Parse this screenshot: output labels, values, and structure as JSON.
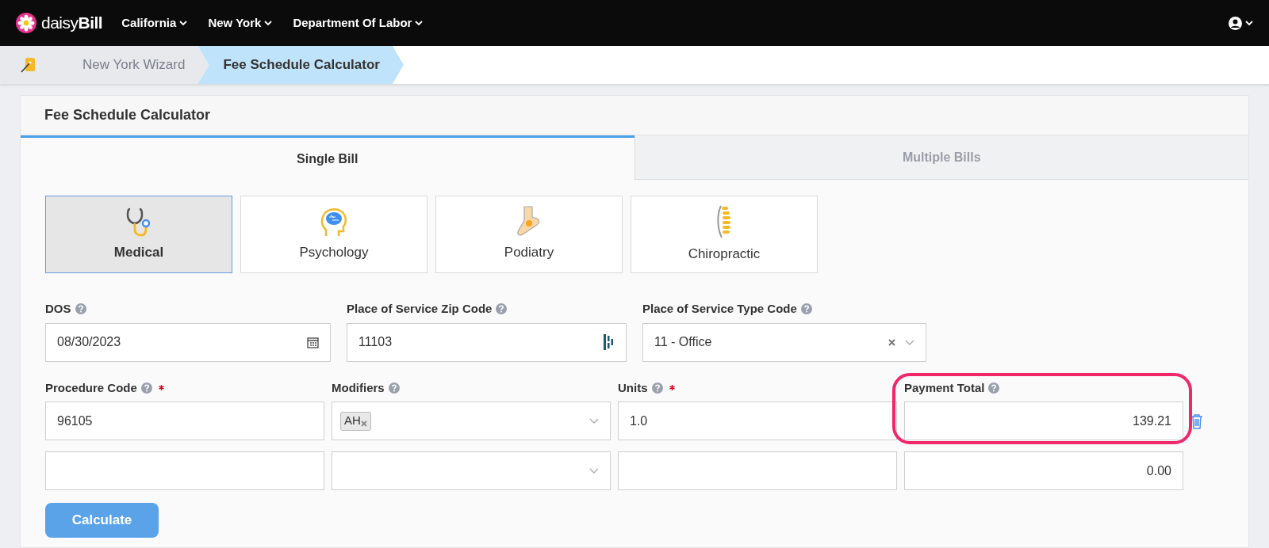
{
  "navbar": {
    "logo": "daisy**Bill**",
    "menus": [
      "California",
      "New York",
      "Department Of Labor"
    ]
  },
  "breadcrumb": [
    {
      "label": "New York Wizard",
      "selected": false
    },
    {
      "label": "Fee Schedule Calculator",
      "selected": true
    }
  ],
  "card": {
    "title": "Fee Schedule Calculator"
  },
  "tabs": [
    {
      "label": "Single Bill",
      "selected": true
    },
    {
      "label": "Multiple Bills",
      "selected": false
    }
  ],
  "categories": [
    {
      "kind": "stethoscope",
      "label": "Medical",
      "selected": true
    },
    {
      "kind": "brain",
      "label": "Psychology",
      "selected": false
    },
    {
      "kind": "foot",
      "label": "Podiatry",
      "selected": false
    },
    {
      "kind": "spine",
      "label": "Chiropractic",
      "selected": false
    }
  ],
  "location_fields": [
    {
      "kind": "date",
      "label": "DOS",
      "value": "08/30/2023"
    },
    {
      "kind": "lookup",
      "label": "Place of Service Zip Code",
      "value": "11103"
    },
    {
      "kind": "select",
      "label": "Place of Service Type Code",
      "value": "11 - Office"
    }
  ],
  "line_columns": [
    {
      "label": "Procedure Code",
      "required": true
    },
    {
      "label": "Modifiers",
      "required": false
    },
    {
      "label": "Units",
      "required": true
    },
    {
      "label": "Payment Total",
      "required": false,
      "highlighted": true
    }
  ],
  "lines": [
    {
      "procedure_code": "96105",
      "modifiers": [
        "AH"
      ],
      "units": "1.0",
      "payment_total": "139.21",
      "deletable": true
    },
    {
      "payment_total": "0.00",
      "deletable": false
    }
  ],
  "calculate_button": "Calculate"
}
